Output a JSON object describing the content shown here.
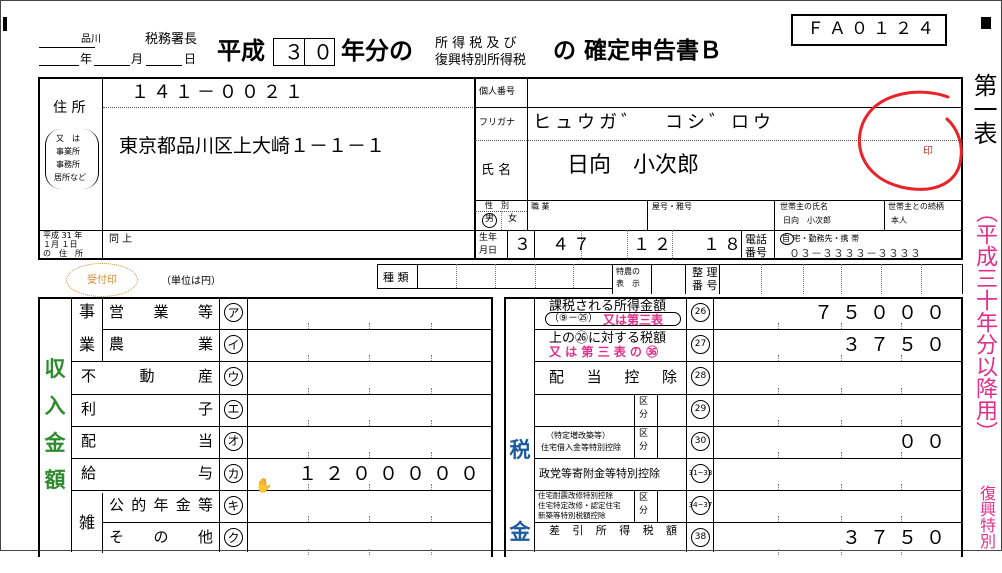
{
  "header": {
    "office_city": "品川",
    "tax_office_suffix": "税務署長",
    "date_year_label": "年",
    "date_month_label": "月",
    "date_day_label": "日",
    "era": "平成",
    "year": "３０",
    "year_suffix": "年分の",
    "tax_type_line1": "所 得 税 及 び",
    "tax_type_line2": "復興特別所得税",
    "title": "の 確定申告書Ｂ",
    "form_code": "ＦＡ０１２４",
    "sheet_label": "第一表",
    "era_note": "（平成三十年分以降用）",
    "side_note2": "復興特別"
  },
  "address": {
    "label": "住 所",
    "sub_label_1": "又　は",
    "sub_label_2": "事業所",
    "sub_label_3": "事務所",
    "sub_label_4": "居所など",
    "postal_code": "１４１－００２１",
    "address_value": "東京都品川区上大崎１－１－１",
    "prev_label_1": "平成 31 年",
    "prev_label_2": "１月 １日",
    "prev_label_3": "の　住　所",
    "prev_value": "同 上"
  },
  "personal": {
    "number_label": "個人番号",
    "furigana_label": "フリガナ",
    "furigana_value": "ヒュウガ゛　コシ゛ロウ",
    "name_label": "氏 名",
    "name_value": "日向　小次郎",
    "seal_label": "印",
    "sex_label": "性　別",
    "sex_male": "男",
    "sex_female": "女",
    "job_label": "職 業",
    "trade_label": "屋号・雅号",
    "householder_label": "世帯主の氏名",
    "householder_value": "日向　小次郎",
    "relation_label": "世帯主との続柄",
    "relation_value": "本人",
    "birth_label_1": "生年",
    "birth_label_2": "月日",
    "birth_era": "３",
    "birth_year": "４７",
    "birth_month": "１２",
    "birth_day": "１８",
    "phone_label_1": "電話",
    "phone_label_2": "番号",
    "phone_types": "自 宅・勤務先・携 帯",
    "phone_value": "０３－３３３３－３３３３",
    "home_circle": "自"
  },
  "form_misc": {
    "received_stamp": "受付印",
    "unit_label": "（単位は円）",
    "kind_label": "種 類",
    "special_label_1": "特農の",
    "special_label_2": "表　示",
    "ref_label_1": "整 理",
    "ref_label_2": "番 号"
  },
  "income": {
    "section_label": [
      "収",
      "入",
      "金",
      "額"
    ],
    "biz_label": [
      "事",
      "業"
    ],
    "misc_label": "雑",
    "rows": [
      {
        "label": "営 業 等",
        "code": "ア",
        "value": ""
      },
      {
        "label": "農　　業",
        "code": "イ",
        "value": ""
      },
      {
        "label": "不　動　産",
        "code": "ウ",
        "value": ""
      },
      {
        "label": "利　　　子",
        "code": "エ",
        "value": ""
      },
      {
        "label": "配　　　当",
        "code": "オ",
        "value": ""
      },
      {
        "label": "給　　　与",
        "code": "カ",
        "value": "１２０００００"
      },
      {
        "label": "公的年金等",
        "code": "キ",
        "value": ""
      },
      {
        "label": "そ　の　他",
        "code": "ク",
        "value": ""
      }
    ]
  },
  "tax": {
    "section_label": [
      "税",
      "金"
    ],
    "rows": [
      {
        "code": "26",
        "label": "課税される所得金額",
        "sub": "（⑨－㉕）",
        "note": "又は第三表",
        "value": "７５０００"
      },
      {
        "code": "27",
        "label": "上の㉖に対する税額",
        "sub": "",
        "note": "又 は 第 三 表 の ㊱",
        "value": "３７５０"
      },
      {
        "code": "28",
        "label": "配　当　控　除",
        "sub": "",
        "note": "",
        "value": ""
      },
      {
        "code": "29",
        "label": "",
        "sub": "区分",
        "note": "",
        "value": ""
      },
      {
        "code": "30",
        "label": "（特定増改築等）",
        "sub": "住宅借入金等特別控除",
        "note": "",
        "value": "００"
      },
      {
        "code": "31~33",
        "label": "政党等寄附金等特別控除",
        "sub": "",
        "note": "",
        "value": ""
      },
      {
        "code": "34~37",
        "label": "住宅耐震改修特別控除",
        "sub": "住宅特定改修・認定住宅",
        "note": "新築等特別税額控除",
        "value": ""
      },
      {
        "code": "38",
        "label": "差　引　所　得　税　額",
        "sub": "",
        "note": "",
        "value": "３７５０"
      }
    ],
    "kubun": "区分"
  },
  "colors": {
    "green": "#2e8b2e",
    "pink": "#e0308c",
    "annotation_red": "#e8232a"
  }
}
